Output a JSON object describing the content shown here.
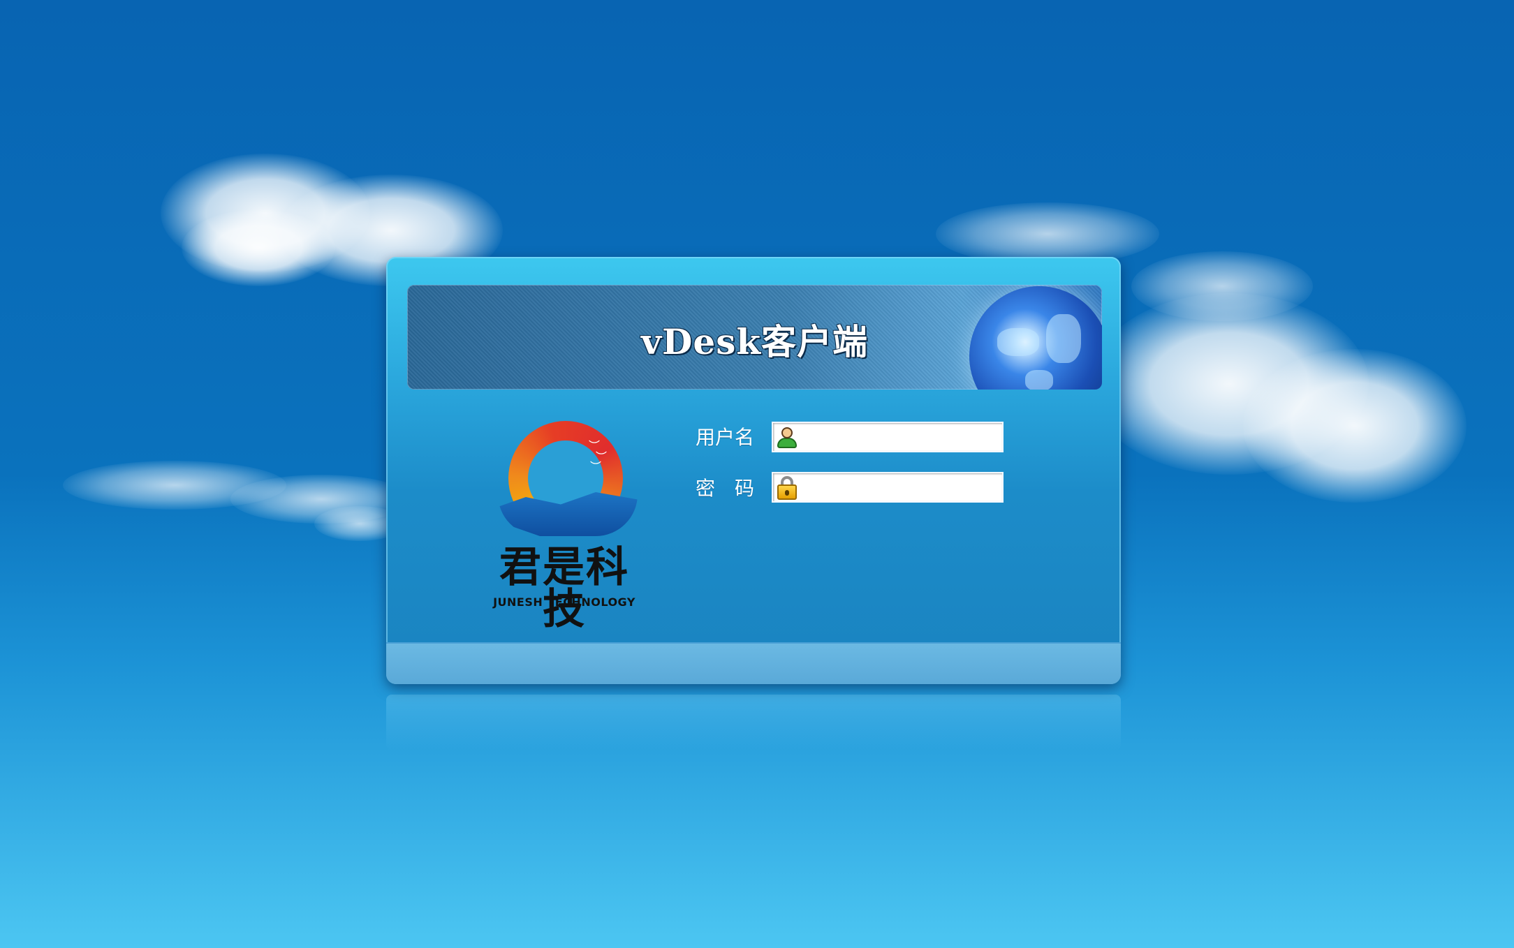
{
  "window": {
    "banner_title": "vDesk客户端"
  },
  "logo": {
    "name_cn": "君是科技",
    "name_en": "JUNESH TECHNOLOGY"
  },
  "form": {
    "username_label": "用户名",
    "username_value": "",
    "password_label": "密　码",
    "password_value": ""
  },
  "icons": {
    "username_icon": "user-icon",
    "password_icon": "lock-icon",
    "banner_art": "globe-icon",
    "birds": "bird-icon"
  },
  "colors": {
    "background_top": "#0864b2",
    "background_bottom": "#4cc6f2",
    "panel": "#2aa6dc",
    "footer": "#5aa9d8"
  }
}
